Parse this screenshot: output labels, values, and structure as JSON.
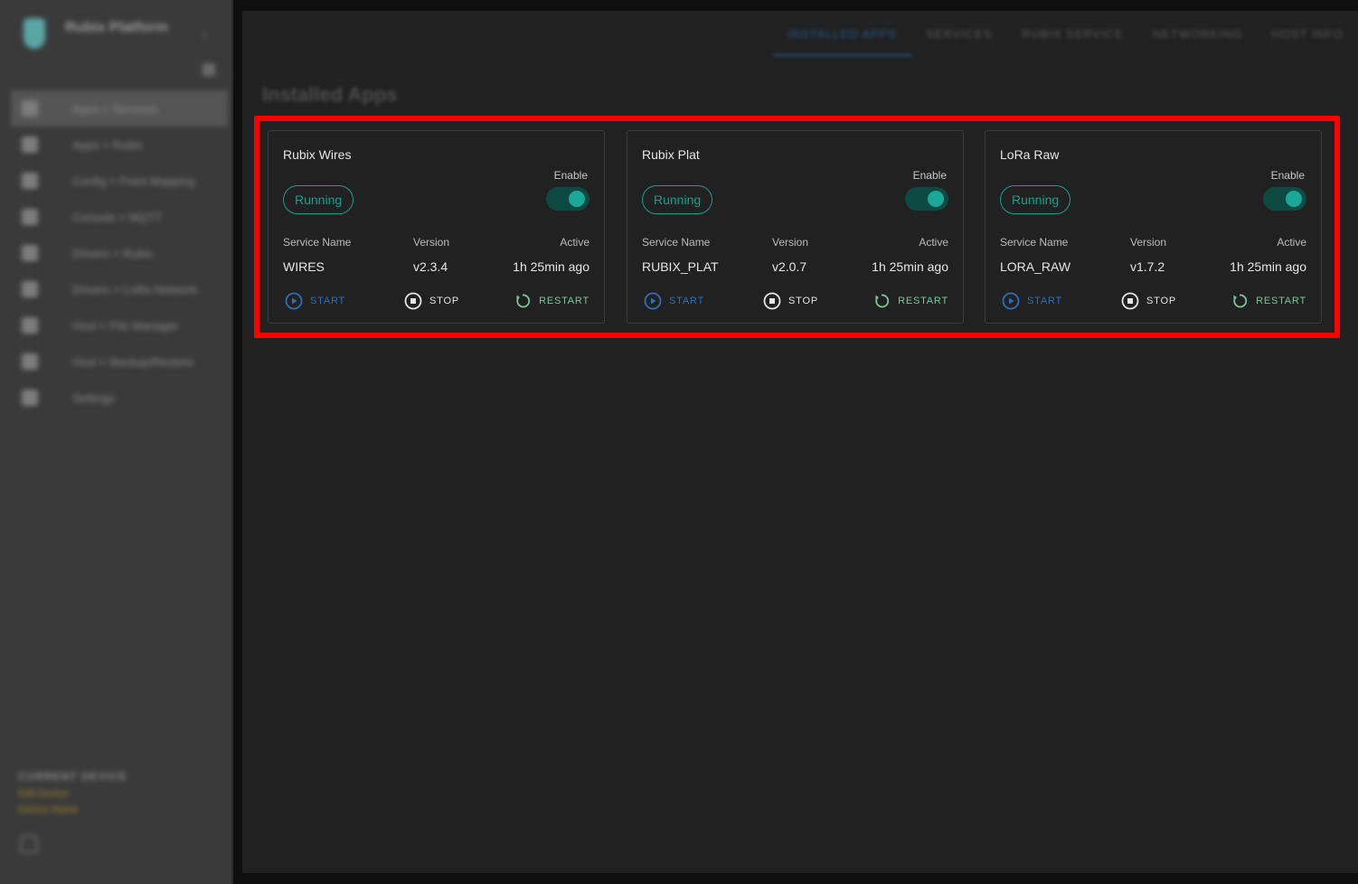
{
  "sidebar": {
    "brand": "Rubix Platform",
    "items": [
      {
        "label": "Apps > Services"
      },
      {
        "label": "Apps > Rubix"
      },
      {
        "label": "Config > Point Mapping"
      },
      {
        "label": "Console > MQTT"
      },
      {
        "label": "Drivers > Rubix"
      },
      {
        "label": "Drivers > LoRa Network"
      },
      {
        "label": "Host > File Manager"
      },
      {
        "label": "Host > Backup/Restore"
      },
      {
        "label": "Settings"
      }
    ],
    "footer": {
      "title": "CURRENT DEVICE",
      "line1": "Edit Device",
      "line2": "Device Name"
    }
  },
  "tabs": [
    {
      "label": "INSTALLED APPS",
      "active": true
    },
    {
      "label": "SERVICES"
    },
    {
      "label": "RUBIX SERVICE"
    },
    {
      "label": "NETWORKING"
    },
    {
      "label": "HOST INFO"
    }
  ],
  "page": {
    "title": "Installed Apps"
  },
  "cards": [
    {
      "title": "Rubix Wires",
      "enable_label": "Enable",
      "status": "Running",
      "headers": {
        "name": "Service Name",
        "version": "Version",
        "active": "Active"
      },
      "values": {
        "name": "WIRES",
        "version": "v2.3.4",
        "active": "1h 25min ago"
      },
      "actions": {
        "start": "START",
        "stop": "STOP",
        "restart": "RESTART"
      }
    },
    {
      "title": "Rubix Plat",
      "enable_label": "Enable",
      "status": "Running",
      "headers": {
        "name": "Service Name",
        "version": "Version",
        "active": "Active"
      },
      "values": {
        "name": "RUBIX_PLAT",
        "version": "v2.0.7",
        "active": "1h 25min ago"
      },
      "actions": {
        "start": "START",
        "stop": "STOP",
        "restart": "RESTART"
      }
    },
    {
      "title": "LoRa Raw",
      "enable_label": "Enable",
      "status": "Running",
      "headers": {
        "name": "Service Name",
        "version": "Version",
        "active": "Active"
      },
      "values": {
        "name": "LORA_RAW",
        "version": "v1.7.2",
        "active": "1h 25min ago"
      },
      "actions": {
        "start": "START",
        "stop": "STOP",
        "restart": "RESTART"
      }
    }
  ],
  "colors": {
    "accent_teal": "#16a08e",
    "start_blue": "#2f6fb6",
    "restart_green": "#7cc59c",
    "highlight_red": "#ff0000"
  }
}
